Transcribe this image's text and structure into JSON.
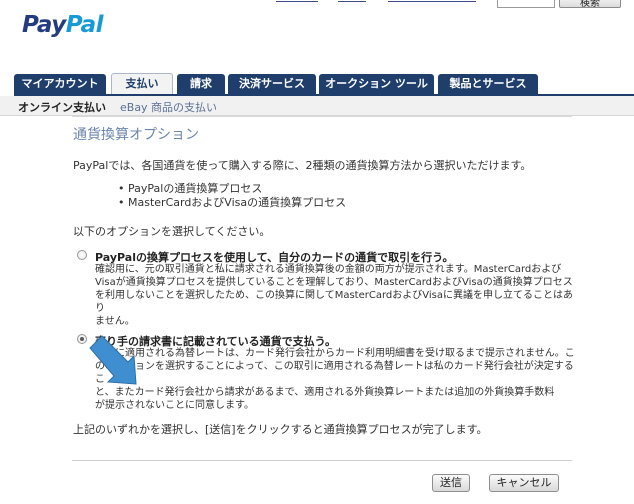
{
  "header": {
    "logo_left": "Pay",
    "logo_right": "Pal",
    "search_button": "検索"
  },
  "tabs": [
    {
      "label": "マイアカウント",
      "active": false
    },
    {
      "label": "支払い",
      "active": true
    },
    {
      "label": "請求",
      "active": false
    },
    {
      "label": "決済サービス",
      "active": false
    },
    {
      "label": "オークション ツール",
      "active": false
    },
    {
      "label": "製品とサービス",
      "active": false
    }
  ],
  "subnav": {
    "active": "オンライン支払い",
    "link": "eBay 商品の支払い"
  },
  "main": {
    "title": "通貨換算オプション",
    "intro": "PayPalでは、各国通貨を使って購入する際に、2種類の通貨換算方法から選択いただけます。",
    "bullets": [
      "PayPalの通貨換算プロセス",
      "MasterCardおよびVisaの通貨換算プロセス"
    ],
    "select_label": "以下のオプションを選択してください。",
    "options": [
      {
        "head": "PayPalの換算プロセスを使用して、自分のカードの通貨で取引を行う。",
        "desc_lines": [
          "確認用に、元の取引通貨と私に請求される通貨換算後の金額の両方が提示されます。MasterCardおよび",
          "Visaが通貨換算プロセスを提供していることを理解しており、MasterCardおよびVisaの通貨換算プロセス",
          "を利用しないことを選択したため、この換算に関してMasterCardおよびVisaに異議を申し立てることはあり",
          "ません。"
        ],
        "checked": false
      },
      {
        "head": "売り手の請求書に記載されている通貨で支払う。",
        "desc_lines": [
          "取引に適用される為替レートは、カード発行会社からカード利用明細書を受け取るまで提示されません。こ",
          "のオプションを選択することによって、この取引に適用される為替レートは私のカード発行会社が決定するこ",
          "と、またカード発行会社から請求があるまで、適用される外貨換算レートまたは追加の外貨換算手数料",
          "が提示されないことに同意します。"
        ],
        "checked": true
      }
    ],
    "outro": "上記のいずれかを選択し、[送信]をクリックすると通貨換算プロセスが完了します。",
    "submit": "送信",
    "cancel": "キャンセル"
  },
  "colors": {
    "tab_bg": "#1f3e6c",
    "title": "#6b86ad",
    "arrow": "#3f8fd0"
  }
}
